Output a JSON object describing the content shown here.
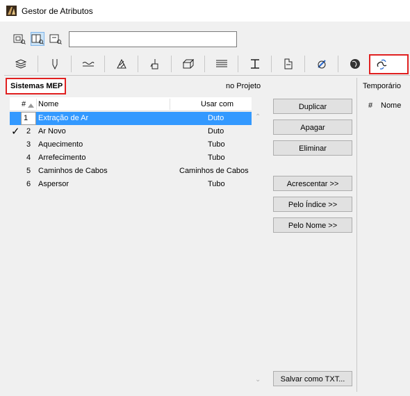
{
  "window": {
    "title": "Gestor de Atributos"
  },
  "toolbar": {
    "view_buttons": [
      "view-single-icon",
      "view-split-icon",
      "view-compare-icon"
    ],
    "search_value": ""
  },
  "tabs": [
    "layers-icon",
    "pen-icon",
    "line-icon",
    "fill-icon",
    "paint-icon",
    "building-material-icon",
    "composite-icon",
    "profile-icon",
    "zone-icon",
    "surface-icon",
    "globe-icon",
    "mep-systems-icon"
  ],
  "left_panel": {
    "section_title": "Sistemas MEP",
    "location_label": "no Projeto",
    "columns": {
      "num": "#",
      "name": "Nome",
      "use_with": "Usar com"
    },
    "rows": [
      {
        "num": "1",
        "name": "Extração de Ar",
        "use_with": "Duto",
        "selected": true,
        "checked": false
      },
      {
        "num": "2",
        "name": "Ar Novo",
        "use_with": "Duto",
        "selected": false,
        "checked": true
      },
      {
        "num": "3",
        "name": "Aquecimento",
        "use_with": "Tubo",
        "selected": false,
        "checked": false
      },
      {
        "num": "4",
        "name": "Arrefecimento",
        "use_with": "Tubo",
        "selected": false,
        "checked": false
      },
      {
        "num": "5",
        "name": "Caminhos de Cabos",
        "use_with": "Caminhos de Cabos",
        "selected": false,
        "checked": false
      },
      {
        "num": "6",
        "name": "Aspersor",
        "use_with": "Tubo",
        "selected": false,
        "checked": false
      }
    ],
    "check_mark": "✓"
  },
  "buttons": {
    "duplicate": "Duplicar",
    "delete": "Apagar",
    "remove": "Eliminar",
    "append": "Acrescentar >>",
    "by_index": "Pelo Índice >>",
    "by_name": "Pelo Nome >>",
    "save_txt": "Salvar como TXT..."
  },
  "right_panel": {
    "location_label": "Temporário",
    "columns": {
      "num": "#",
      "name": "Nome"
    }
  },
  "colors": {
    "selection": "#3399ff",
    "highlight_border": "#e02020"
  }
}
